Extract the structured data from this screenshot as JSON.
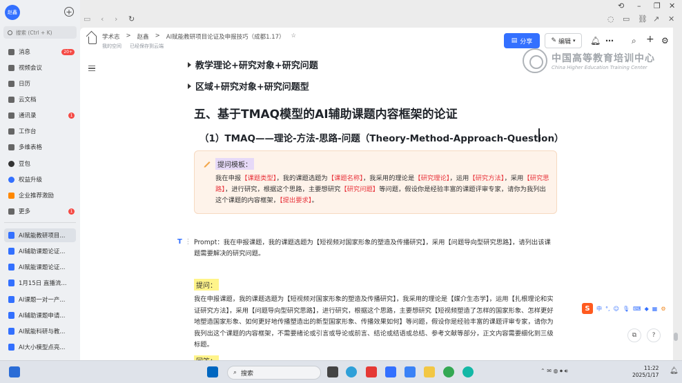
{
  "user": {
    "avatar_text": "赵鑫"
  },
  "sidebar": {
    "search_placeholder": "搜索 (Ctrl + K)",
    "items": [
      {
        "label": "消息",
        "badge": "20+",
        "icon": "message-icon"
      },
      {
        "label": "视频会议",
        "badge": "",
        "icon": "video-icon"
      },
      {
        "label": "日历",
        "badge": "",
        "icon": "calendar-icon"
      },
      {
        "label": "云文档",
        "badge": "",
        "icon": "cloud-doc-icon"
      },
      {
        "label": "通讯录",
        "badge": "1",
        "icon": "contacts-icon"
      },
      {
        "label": "工作台",
        "badge": "",
        "icon": "workbench-icon"
      },
      {
        "label": "多维表格",
        "badge": "",
        "icon": "table-icon"
      },
      {
        "label": "豆包",
        "badge": "",
        "icon": "doubao-icon"
      },
      {
        "label": "权益升级",
        "badge": "",
        "icon": "upgrade-icon"
      },
      {
        "label": "企业推荐激励",
        "badge": "",
        "icon": "reward-icon"
      },
      {
        "label": "更多",
        "badge": "1",
        "icon": "more-grid-icon"
      }
    ],
    "docs": [
      {
        "label": "AI赋能教研项目..."
      },
      {
        "label": "AI辅助课题论证..."
      },
      {
        "label": "AI赋能课题论证..."
      },
      {
        "label": "1月15日 直播流..."
      },
      {
        "label": "AI课题一对一产..."
      },
      {
        "label": "AI辅助课题申请..."
      },
      {
        "label": "AI赋能科研与教..."
      },
      {
        "label": "AI大小模型点亮..."
      }
    ]
  },
  "header": {
    "breadcrumb": [
      "学术志",
      "赵鑫",
      "AI赋能教研项目论证及申报技巧（成都1.17）"
    ],
    "space": "我的空间",
    "saved": "已经保存到云端",
    "share_label": "分享",
    "edit_label": "编辑"
  },
  "watermark": {
    "cn": "中国高等教育培训中心",
    "en": "China Higher Education Training Center"
  },
  "doc": {
    "bullet1": "教学理论+研究对象+研究问题",
    "bullet2": "区域+研究对象+研究问题型",
    "h2": "五、基于TMAQ模型的AI辅助课题内容框架的论证",
    "h3": "（1）TMAQ——理论-方法-思路-问题（Theory-Method-Approach-Question）",
    "template_label": "提问模板：",
    "template": [
      {
        "t": "我在申报",
        "r": false
      },
      {
        "t": "【课题类型】",
        "r": true
      },
      {
        "t": "，我的课题选题为",
        "r": false
      },
      {
        "t": "【课题名称】",
        "r": true
      },
      {
        "t": "，我采用的理论是",
        "r": false
      },
      {
        "t": "【研究理论】",
        "r": true
      },
      {
        "t": "，运用",
        "r": false
      },
      {
        "t": "【研究方法】",
        "r": true
      },
      {
        "t": "，采用",
        "r": false
      },
      {
        "t": "【研究思路】",
        "r": true
      },
      {
        "t": "，进行研究，根据这个思路，主要想研究",
        "r": false
      },
      {
        "t": "【研究问题】",
        "r": true
      },
      {
        "t": "等问题，假设你是经验丰富的课题评审专家，请你为我列出这个课题的内容框架，",
        "r": false
      },
      {
        "t": "【提出要求】",
        "r": true
      },
      {
        "t": "。",
        "r": false
      }
    ],
    "prompt": "Prompt：我在申报课题，我的课题选题为【短视频对国家形象的塑造及传播研究】，采用【问题导向型研究思路】，请列出该课题需要解决的研究问题。",
    "question_label": "提问：",
    "question": "我在申报课题，我的课题选题为【短视频对国家形象的塑造及传播研究】，我采用的理论是【媒介生态学】，运用【扎根理论和实证研究方法】，采用【问题导向型研究思路】，进行研究，根据这个思路，主要想研究【短视频塑造了怎样的国家形象、怎样更好地塑造国家形象、如何更好地传播塑造出的新型国家形象、传播效果如何】等问题，假设你是经验丰富的课题评审专家，请你为我列出这个课题的内容框架，不需要绪论或引言或导论或前言、结论或结语或总结、参考文献等部分，正文内容需要细化到三级标题。",
    "answer_label": "回答："
  },
  "ime": {
    "badge": "S",
    "items": [
      "中",
      "°,"
    ]
  },
  "taskbar": {
    "search": "搜索",
    "time": "11:22",
    "date": "2025/1/17"
  }
}
